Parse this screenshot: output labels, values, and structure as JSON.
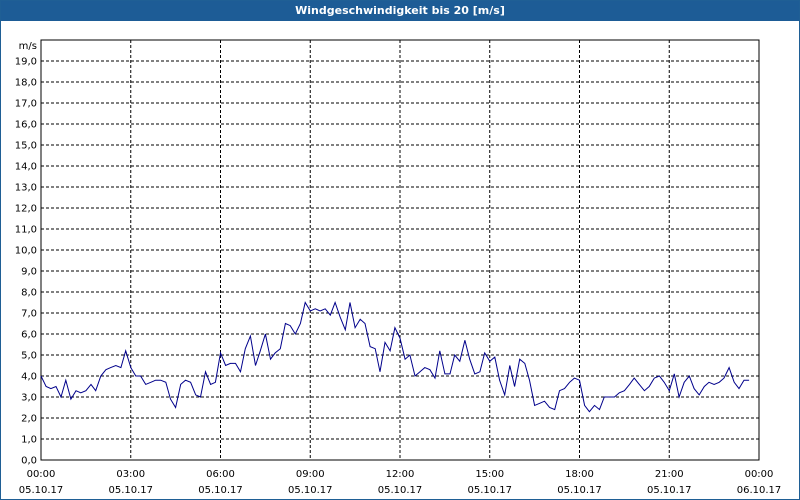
{
  "window": {
    "title": "Windgeschwindigkeit bis 20 [m/s]",
    "title_bar_color": "#1d5c96"
  },
  "chart_data": {
    "type": "line",
    "title": "Windgeschwindigkeit bis 20 [m/s]",
    "ylabel": "m/s",
    "xlabel": "",
    "ylim": [
      0,
      20
    ],
    "y_ticks": [
      "0,0",
      "1,0",
      "2,0",
      "3,0",
      "4,0",
      "5,0",
      "6,0",
      "7,0",
      "8,0",
      "9,0",
      "10,0",
      "11,0",
      "12,0",
      "13,0",
      "14,0",
      "15,0",
      "16,0",
      "17,0",
      "18,0",
      "19,0"
    ],
    "x_ticks": [
      {
        "time": "00:00",
        "date": "05.10.17"
      },
      {
        "time": "03:00",
        "date": "05.10.17"
      },
      {
        "time": "06:00",
        "date": "05.10.17"
      },
      {
        "time": "09:00",
        "date": "05.10.17"
      },
      {
        "time": "12:00",
        "date": "05.10.17"
      },
      {
        "time": "15:00",
        "date": "05.10.17"
      },
      {
        "time": "18:00",
        "date": "05.10.17"
      },
      {
        "time": "21:00",
        "date": "05.10.17"
      },
      {
        "time": "00:00",
        "date": "06.10.17"
      }
    ],
    "x_range_hours": [
      0,
      24
    ],
    "grid": true,
    "grid_style": "dashed",
    "series_color": "#00008b",
    "series": [
      {
        "hours": [
          0.0,
          0.17,
          0.33,
          0.5,
          0.67,
          0.83,
          1.0,
          1.17,
          1.33,
          1.5,
          1.67,
          1.83,
          2.0,
          2.17,
          2.33,
          2.5,
          2.67,
          2.83,
          3.0,
          3.17,
          3.33,
          3.5,
          3.67,
          3.83,
          4.0,
          4.17,
          4.33,
          4.5,
          4.67,
          4.83,
          5.0,
          5.17,
          5.33,
          5.5,
          5.67,
          5.83,
          6.0,
          6.17,
          6.33,
          6.5,
          6.67,
          6.83,
          7.0,
          7.17,
          7.33,
          7.5,
          7.67,
          7.83,
          8.0,
          8.17,
          8.33,
          8.5,
          8.67,
          8.83,
          9.0,
          9.17,
          9.33,
          9.5,
          9.67,
          9.83,
          10.0,
          10.17,
          10.33,
          10.5,
          10.67,
          10.83,
          11.0,
          11.17,
          11.33,
          11.5,
          11.67,
          11.83,
          12.0,
          12.17,
          12.33,
          12.5,
          12.67,
          12.83,
          13.0,
          13.17,
          13.33,
          13.5,
          13.67,
          13.83,
          14.0,
          14.17,
          14.33,
          14.5,
          14.67,
          14.83,
          15.0,
          15.17,
          15.33,
          15.5,
          15.67,
          15.83,
          16.0,
          16.17,
          16.33,
          16.5,
          16.67,
          16.83,
          17.0,
          17.17,
          17.33,
          17.5,
          17.67,
          17.83,
          18.0,
          18.17,
          18.33,
          18.5,
          18.67,
          18.83,
          19.0,
          19.17,
          19.33,
          19.5,
          19.67,
          19.83,
          20.0,
          20.17,
          20.33,
          20.5,
          20.67,
          20.83,
          21.0,
          21.17,
          21.33,
          21.5,
          21.67,
          21.83,
          22.0,
          22.17,
          22.33,
          22.5,
          22.67,
          22.83,
          23.0,
          23.17,
          23.33,
          23.5,
          23.67,
          23.83,
          24.0
        ],
        "values": [
          4.0,
          3.5,
          3.4,
          3.5,
          3.0,
          3.8,
          2.9,
          3.3,
          3.2,
          3.3,
          3.6,
          3.3,
          4.0,
          4.3,
          4.4,
          4.5,
          4.4,
          5.2,
          4.4,
          4.0,
          4.0,
          3.6,
          3.7,
          3.8,
          3.8,
          3.7,
          2.9,
          2.5,
          3.6,
          3.8,
          3.7,
          3.1,
          3.0,
          4.2,
          3.6,
          3.7,
          5.1,
          4.5,
          4.6,
          4.6,
          4.2,
          5.3,
          5.9,
          4.5,
          5.2,
          6.0,
          4.8,
          5.1,
          5.3,
          6.5,
          6.4,
          6.0,
          6.5,
          7.5,
          7.1,
          7.2,
          7.1,
          7.2,
          6.9,
          7.5,
          6.8,
          6.2,
          7.5,
          6.3,
          6.7,
          6.5,
          5.4,
          5.3,
          4.2,
          5.6,
          5.2,
          6.3,
          5.8,
          4.8,
          5.0,
          4.0,
          4.2,
          4.4,
          4.3,
          3.9,
          5.2,
          4.1,
          4.1,
          5.0,
          4.7,
          5.7,
          4.8,
          4.1,
          4.2,
          5.1,
          4.7,
          4.9,
          3.8,
          3.1,
          4.5,
          3.5,
          4.8,
          4.6,
          3.8,
          2.6,
          2.7,
          2.8,
          2.5,
          2.4,
          3.3,
          3.4,
          3.7,
          3.9,
          3.8,
          2.6,
          2.3,
          2.6,
          2.4,
          3.0,
          3.0,
          3.0,
          3.2,
          3.3,
          3.6,
          3.9,
          3.6,
          3.3,
          3.5,
          3.9,
          4.0,
          3.7,
          3.3,
          4.1,
          3.0,
          3.7,
          4.0,
          3.4,
          3.1,
          3.5,
          3.7,
          3.6,
          3.7,
          3.9,
          4.4,
          3.7,
          3.4,
          3.8,
          3.8
        ]
      }
    ]
  }
}
